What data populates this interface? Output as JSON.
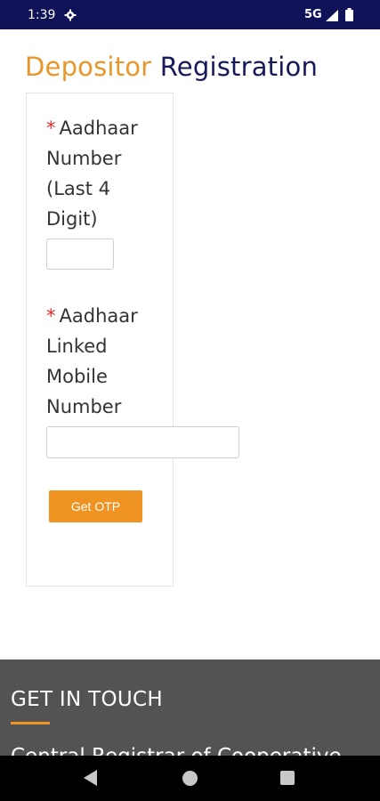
{
  "status_bar": {
    "time": "1:39",
    "network": "5G",
    "icons": [
      "gear-icon",
      "signal-icon",
      "battery-icon"
    ]
  },
  "page": {
    "title_part1": "Depositor",
    "title_part2": "Registration",
    "title_colors": {
      "part1": "#e9962a",
      "part2": "#17195a"
    }
  },
  "form": {
    "required_marker": "*",
    "aadhaar_last4": {
      "label_lines": [
        "Aadhaar",
        "Number",
        "(Last 4",
        "Digit)"
      ],
      "value": ""
    },
    "mobile": {
      "label_lines": [
        "Aadhaar",
        "Linked",
        "Mobile",
        "Number"
      ],
      "value": ""
    },
    "otp_button_label": "Get OTP",
    "accent": "#ef9423"
  },
  "footer": {
    "heading": "GET IN TOUCH",
    "org_text": "Central Registrar of Cooperative"
  },
  "nav_bar": {
    "buttons": [
      "back-icon",
      "home-icon",
      "recents-icon"
    ]
  }
}
